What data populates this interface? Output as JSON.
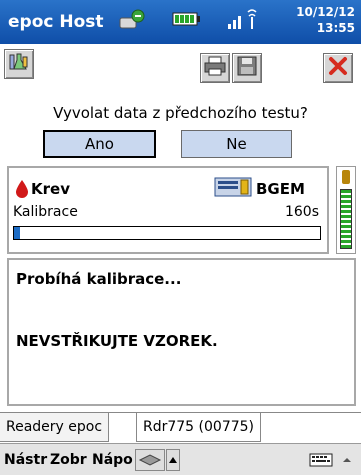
{
  "titlebar": {
    "title": "epoc Host",
    "date": "10/12/12",
    "time": "13:55",
    "icons": [
      "sync-icon",
      "battery-icon",
      "signal-icon"
    ]
  },
  "toolbar": {
    "buttons": [
      "lab-flask-icon",
      "print-icon",
      "save-icon",
      "close-icon"
    ],
    "close_color": "#d62b1f"
  },
  "prompt": {
    "question": "Vyvolat data z předchozího testu?",
    "yes_label": "Ano",
    "no_label": "Ne"
  },
  "status": {
    "sample_type": "Krev",
    "card_type": "BGEM",
    "phase": "Kalibrace",
    "elapsed": "160s",
    "progress_fraction": 0.02,
    "progress_color": "#1d6cc5",
    "blood_color": "#d11919"
  },
  "messages": {
    "line1": "Probíhá kalibrace...",
    "line2": "NEVSTŘIKUJTE VZOREK."
  },
  "tabs": [
    {
      "label": "Readery epoc",
      "active": false
    },
    {
      "label": "Rdr775 (00775)",
      "active": true
    }
  ],
  "menubar": {
    "items": [
      "Nástr",
      "Zobr",
      "Nápo"
    ],
    "icons": [
      "reader-card-icon",
      "up-arrow-icon",
      "keyboard-icon"
    ]
  },
  "colors": {
    "titlebar": "#1a5fb8",
    "button_face": "#c9d8ef"
  }
}
